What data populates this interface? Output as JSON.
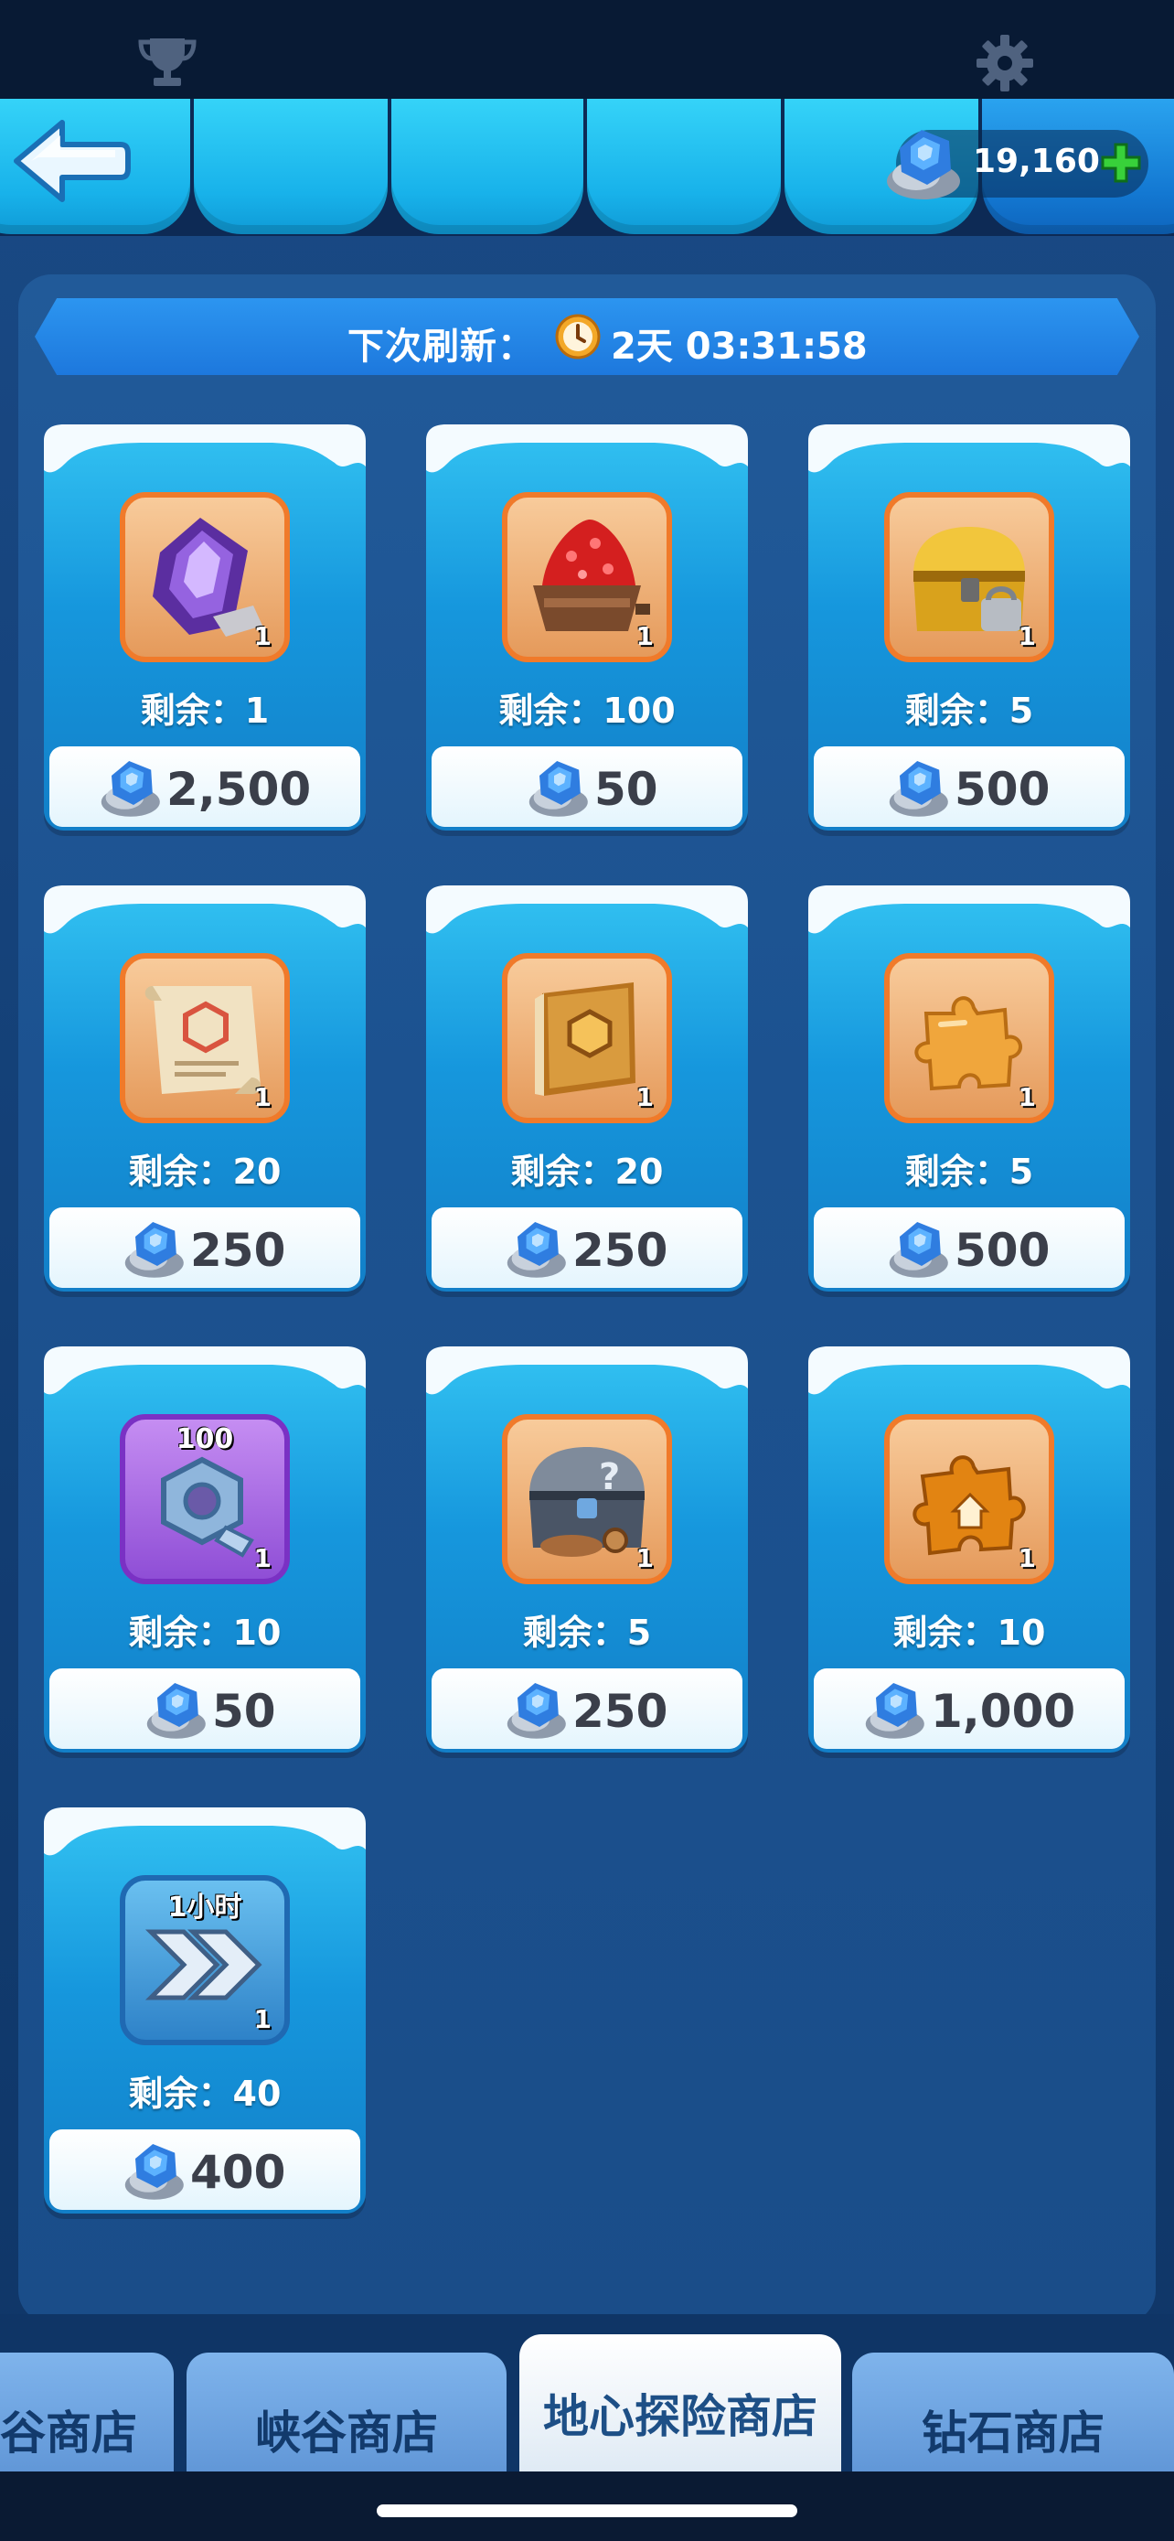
{
  "header": {
    "currency": {
      "icon": "blue-gem-icon",
      "amount": "19,160"
    }
  },
  "refresh": {
    "label": "下次刷新：",
    "time": "2天 03:31:58"
  },
  "items": [
    {
      "name": "purple-crystal",
      "icon": "purple-crystal-icon",
      "count": "1",
      "remaining": "剩余：1",
      "price": "2,500"
    },
    {
      "name": "red-ore-cart",
      "icon": "red-ore-cart-icon",
      "count": "1",
      "remaining": "剩余：100",
      "price": "50"
    },
    {
      "name": "golden-chest",
      "icon": "golden-chest-icon",
      "count": "1",
      "remaining": "剩余：5",
      "price": "500"
    },
    {
      "name": "blueprint-scroll",
      "icon": "scroll-icon",
      "count": "1",
      "remaining": "剩余：20",
      "price": "250"
    },
    {
      "name": "hexagon-book",
      "icon": "book-icon",
      "count": "1",
      "remaining": "剩余：20",
      "price": "250"
    },
    {
      "name": "puzzle-piece",
      "icon": "puzzle-piece-icon",
      "count": "1",
      "remaining": "剩余：5",
      "price": "500"
    },
    {
      "name": "hex-nut",
      "icon": "hex-nut-icon",
      "top_label": "100",
      "count": "1",
      "remaining": "剩余：10",
      "price": "50"
    },
    {
      "name": "mystery-chest",
      "icon": "mystery-chest-icon",
      "count": "1",
      "remaining": "剩余：5",
      "price": "250"
    },
    {
      "name": "orange-puzzle-piece",
      "icon": "orange-puzzle-icon",
      "count": "1",
      "remaining": "剩余：10",
      "price": "1,000"
    },
    {
      "name": "speedup-1h",
      "icon": "fast-forward-icon",
      "top_label": "1小时",
      "count": "1",
      "remaining": "剩余：40",
      "price": "400"
    }
  ],
  "bottom_tabs": [
    {
      "label": "谷商店",
      "active": false
    },
    {
      "label": "峡谷商店",
      "active": false
    },
    {
      "label": "地心探险商店",
      "active": true
    },
    {
      "label": "钻石商店",
      "active": false
    }
  ]
}
